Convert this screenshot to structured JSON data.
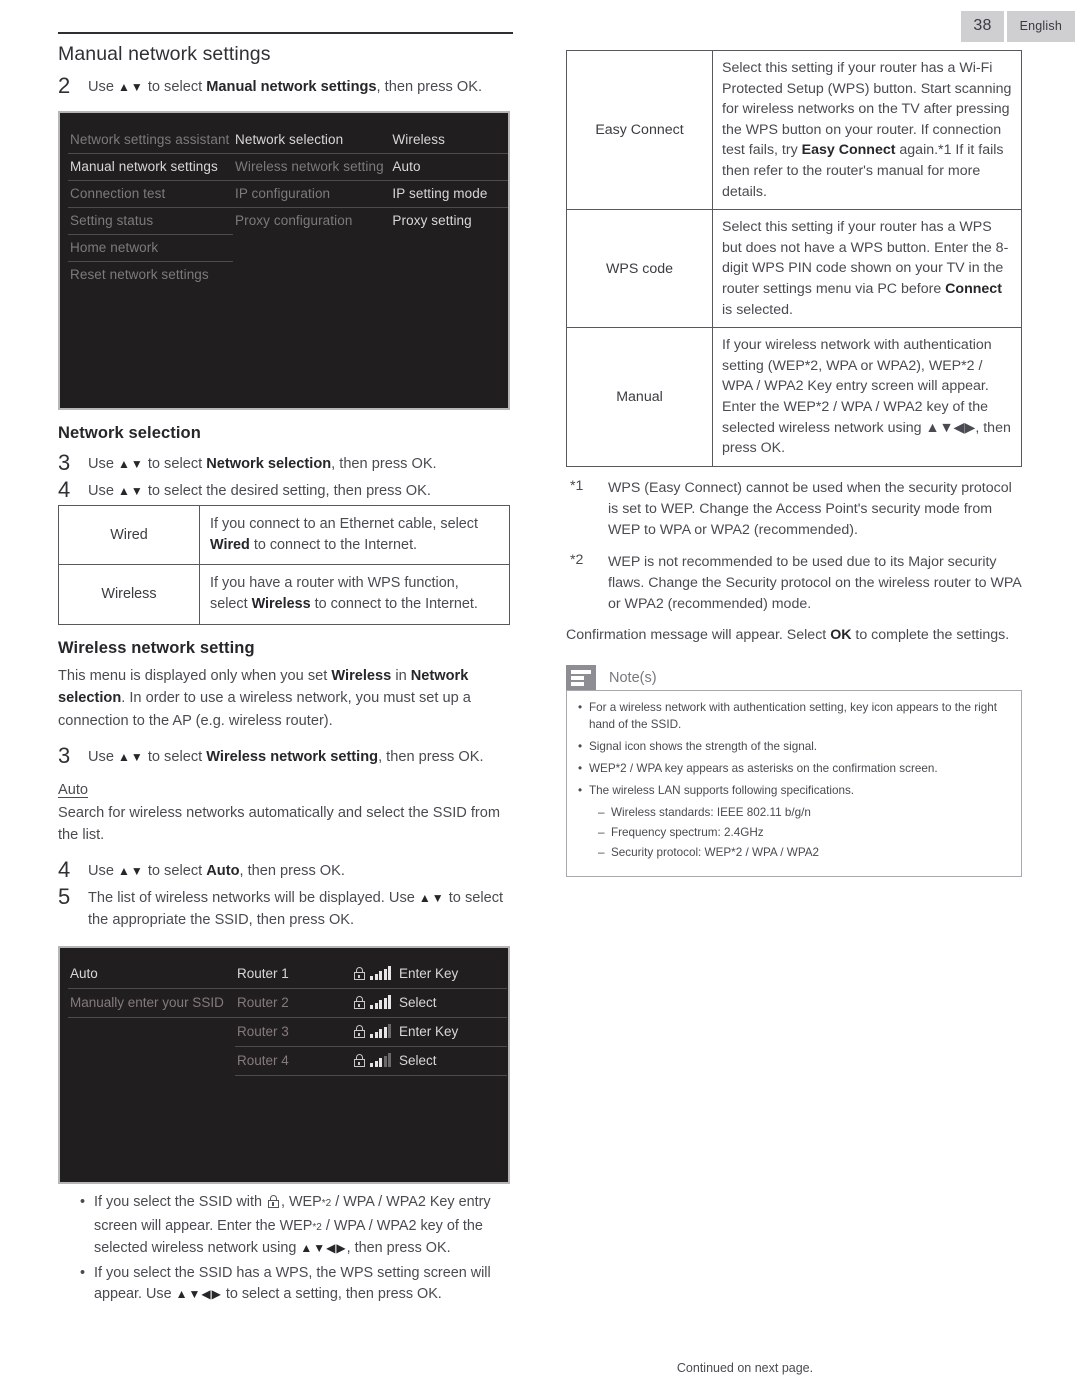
{
  "header": {
    "page_number": "38",
    "language": "English"
  },
  "left": {
    "section_title": "Manual network settings",
    "step2": {
      "num": "2",
      "pre": "Use ",
      "arrows": "▲▼",
      "mid": " to select ",
      "bold": "Manual network settings",
      "post": ", then press OK."
    },
    "tv_menu": {
      "col1": [
        {
          "label": "Network settings assistant",
          "state": "dim"
        },
        {
          "label": "Manual network settings",
          "state": "active"
        },
        {
          "label": "Connection test",
          "state": "dim"
        },
        {
          "label": "Setting status",
          "state": "dim"
        },
        {
          "label": "Home network",
          "state": "dim"
        },
        {
          "label": "Reset network settings",
          "state": "dim"
        }
      ],
      "col2": [
        {
          "label": "Network selection",
          "state": "active"
        },
        {
          "label": "Wireless network setting",
          "state": "dim"
        },
        {
          "label": "IP configuration",
          "state": "dim"
        },
        {
          "label": "Proxy configuration",
          "state": "dim"
        }
      ],
      "col3": [
        {
          "label": "Wireless",
          "state": "active"
        },
        {
          "label": "Auto",
          "state": "active"
        },
        {
          "label": "IP setting mode",
          "state": "active"
        },
        {
          "label": "Proxy setting",
          "state": "active"
        }
      ]
    },
    "network_selection": {
      "heading": "Network selection",
      "step3": {
        "num": "3",
        "pre": "Use ",
        "arrows": "▲▼",
        "mid": " to select ",
        "bold": "Network selection",
        "post": ", then press OK."
      },
      "step4": {
        "num": "4",
        "pre": "Use ",
        "arrows": "▲▼",
        "mid": " to select the desired setting, then press OK.",
        "bold": "",
        "post": ""
      },
      "table": [
        {
          "key": "Wired",
          "value_a": "If you connect to an Ethernet cable, select ",
          "value_b": "Wired",
          "value_c": " to connect to the Internet."
        },
        {
          "key": "Wireless",
          "value_a": "If you have a router with WPS function, select ",
          "value_b": "Wireless",
          "value_c": " to connect to the Internet."
        }
      ]
    },
    "wireless_network_setting": {
      "heading": "Wireless network setting",
      "intro_a": "This menu is displayed only when you set ",
      "intro_b": "Wireless",
      "intro_c": " in ",
      "intro_d": "Network selection",
      "intro_e": ". In order to use a wireless network, you must set up a connection to the AP (e.g. wireless router).",
      "step3": {
        "num": "3",
        "pre": "Use ",
        "arrows": "▲▼",
        "mid": " to select ",
        "bold": "Wireless network setting",
        "post": ", then press OK."
      },
      "auto_heading": "Auto",
      "auto_text": "Search for wireless networks automatically and select the SSID from the list.",
      "step4": {
        "num": "4",
        "pre": "Use ",
        "arrows": "▲▼",
        "mid": " to select ",
        "bold": "Auto",
        "post": ", then press OK."
      },
      "step5": {
        "num": "5",
        "pre": "The list of wireless networks will be displayed. Use ",
        "arrows": "▲▼",
        "mid": " to select the appropriate the SSID, then press OK.",
        "bold": "",
        "post": ""
      }
    },
    "router_screen": {
      "left_items": [
        {
          "label": "Auto",
          "state": "active"
        },
        {
          "label": "Manually enter your SSID",
          "state": "dim"
        }
      ],
      "routers": [
        {
          "name": "Router 1",
          "state": "active",
          "bars": 5,
          "action": "Enter Key",
          "locked": true
        },
        {
          "name": "Router 2",
          "state": "dim",
          "bars": 5,
          "action": "Select",
          "locked": true
        },
        {
          "name": "Router 3",
          "state": "dim",
          "bars": 4,
          "action": "Enter Key",
          "locked": true
        },
        {
          "name": "Router 4",
          "state": "dim",
          "bars": 3,
          "action": "Select",
          "locked": true
        }
      ]
    },
    "bullets": [
      {
        "a": "If you select the SSID with ",
        "icon": "lock-icon",
        "b": ", WEP",
        "sup1": "*2",
        "c": " / WPA / WPA2 Key entry screen will appear. Enter the WEP",
        "sup2": "*2",
        "d": " / WPA / WPA2 key of the selected wireless network using ",
        "arrows": "▲▼◀▶",
        "e": ", then press OK."
      },
      {
        "a": "If you select the SSID has a WPS, the WPS setting screen will appear. Use ",
        "arrows": "▲▼◀▶",
        "e": " to select a setting, then press OK."
      }
    ]
  },
  "right": {
    "table": [
      {
        "key": "Easy Connect",
        "value_pre": "Select this setting if your router has a Wi-Fi Protected Setup (WPS) button. Start scanning for wireless networks on the TV after pressing the WPS button on your router. If connection test fails, try ",
        "value_bold": "Easy Connect",
        "value_post": " again.*1 If it fails then refer to the router's manual for more details."
      },
      {
        "key": "WPS code",
        "value_pre": "Select this setting if your router has a WPS but does not have a WPS button. Enter the 8-digit WPS PIN code shown on your TV in the router settings menu via PC before ",
        "value_bold": "Connect",
        "value_post": " is selected."
      },
      {
        "key": "Manual",
        "value_pre": "If your wireless network with authentication setting (WEP*2, WPA or WPA2), WEP*2 / WPA / WPA2 Key entry screen will appear. Enter the WEP*2 / WPA / WPA2 key of the selected wireless network using ▲▼◀▶, then press OK.",
        "value_bold": "",
        "value_post": ""
      }
    ],
    "footnotes": [
      {
        "marker": "*1",
        "text": "WPS (Easy Connect) cannot be used when the security protocol is set to WEP. Change the Access Point's security mode from WEP to WPA or WPA2 (recommended)."
      },
      {
        "marker": "*2",
        "text": "WEP is not recommended to be used due to its Major security flaws. Change the Security protocol on the wireless router to WPA or WPA2 (recommended) mode."
      }
    ],
    "confirmation_pre": "Confirmation message will appear. Select ",
    "confirmation_bold": "OK",
    "confirmation_post": " to complete the settings.",
    "notes": {
      "label": "Note(s)",
      "items": [
        "For a wireless network with authentication setting, key icon appears to the right hand of the SSID.",
        "Signal icon shows the strength of the signal.",
        "WEP*2 / WPA key appears as asterisks on the confirmation screen.",
        "The wireless LAN supports following specifications."
      ],
      "sub_items": [
        "Wireless standards: IEEE 802.11 b/g/n",
        "Frequency spectrum: 2.4GHz",
        "Security protocol: WEP*2 / WPA / WPA2"
      ]
    }
  },
  "footer": {
    "text": "Continued on next page."
  }
}
